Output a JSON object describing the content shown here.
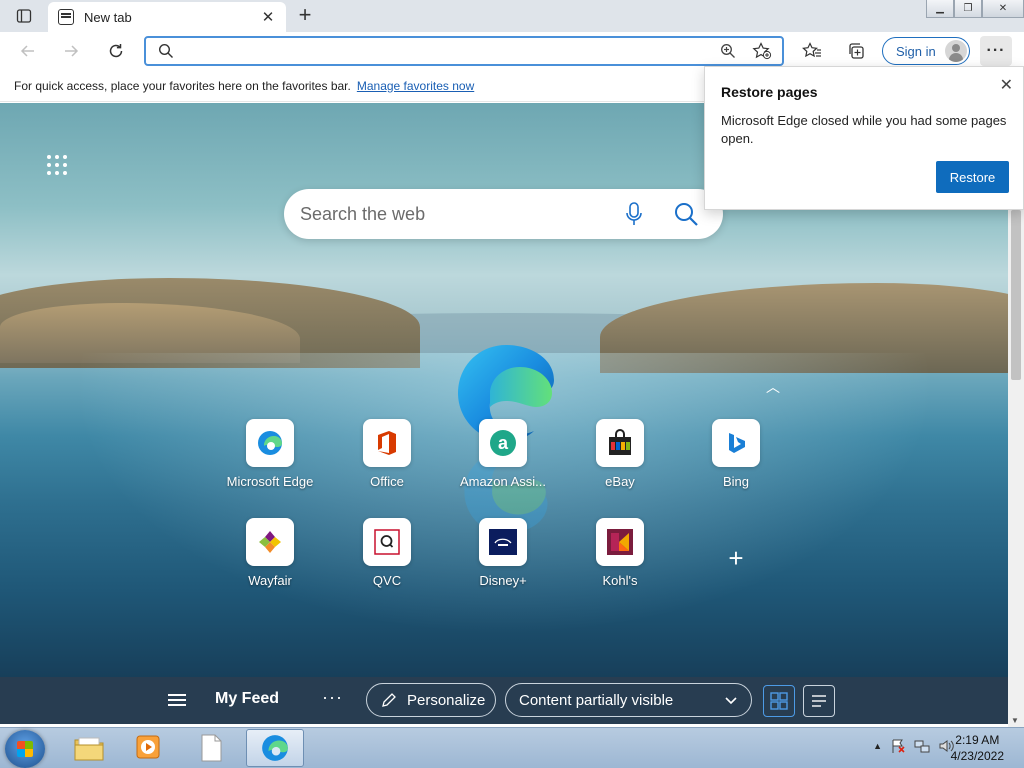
{
  "browser": {
    "tab_title": "New tab",
    "new_tab_symbol": "+",
    "address_value": "",
    "address_placeholder": "",
    "signin_label": "Sign in"
  },
  "favorites_bar": {
    "message": "For quick access, place your favorites here on the favorites bar.",
    "link_label": "Manage favorites now"
  },
  "search": {
    "placeholder": "Search the web"
  },
  "quick_links": [
    {
      "label": "Microsoft Edge",
      "icon": "edge-icon"
    },
    {
      "label": "Office",
      "icon": "office-icon"
    },
    {
      "label": "Amazon Assi...",
      "icon": "amazon-icon"
    },
    {
      "label": "eBay",
      "icon": "ebay-icon"
    },
    {
      "label": "Bing",
      "icon": "bing-icon"
    },
    {
      "label": "Wayfair",
      "icon": "wayfair-icon"
    },
    {
      "label": "QVC",
      "icon": "qvc-icon"
    },
    {
      "label": "Disney+",
      "icon": "disney-icon"
    },
    {
      "label": "Kohl's",
      "icon": "kohls-icon"
    }
  ],
  "feed": {
    "title": "My Feed",
    "personalize_label": "Personalize",
    "content_visibility": "Content partially visible"
  },
  "restore_popup": {
    "title": "Restore pages",
    "message": "Microsoft Edge closed while you had some pages open.",
    "button_label": "Restore"
  },
  "taskbar": {
    "time": "2:19 AM",
    "date": "4/23/2022"
  },
  "colors": {
    "accent": "#0f6cbd",
    "address_focus": "#4a90d9"
  }
}
